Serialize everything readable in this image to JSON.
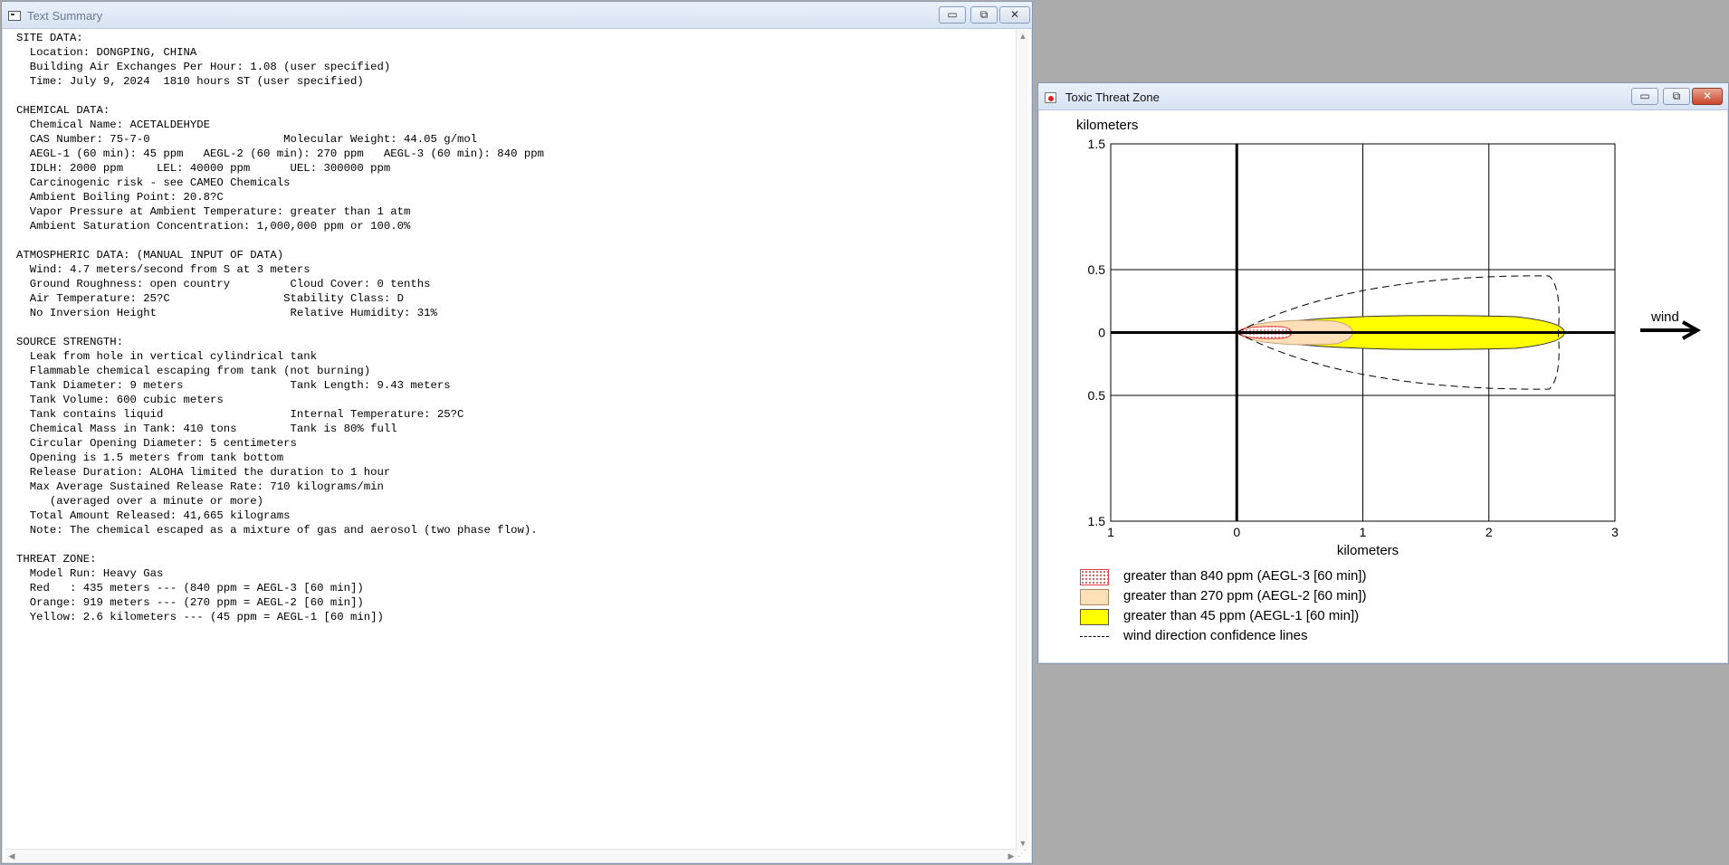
{
  "text_window": {
    "title": "Text Summary",
    "controls": {
      "minimize": "▭",
      "maximize": "⧉",
      "close": "✕"
    },
    "icon": "app-window-icon",
    "lines": [
      "SITE DATA:",
      "  Location: DONGPING, CHINA",
      "  Building Air Exchanges Per Hour: 1.08 (user specified)",
      "  Time: July 9, 2024  1810 hours ST (user specified)",
      "",
      "CHEMICAL DATA:",
      "  Chemical Name: ACETALDEHYDE",
      "  CAS Number: 75-7-0                    Molecular Weight: 44.05 g/mol",
      "  AEGL-1 (60 min): 45 ppm   AEGL-2 (60 min): 270 ppm   AEGL-3 (60 min): 840 ppm",
      "  IDLH: 2000 ppm     LEL: 40000 ppm      UEL: 300000 ppm",
      "  Carcinogenic risk - see CAMEO Chemicals",
      "  Ambient Boiling Point: 20.8?C",
      "  Vapor Pressure at Ambient Temperature: greater than 1 atm",
      "  Ambient Saturation Concentration: 1,000,000 ppm or 100.0%",
      "",
      "ATMOSPHERIC DATA: (MANUAL INPUT OF DATA)",
      "  Wind: 4.7 meters/second from S at 3 meters",
      "  Ground Roughness: open country         Cloud Cover: 0 tenths",
      "  Air Temperature: 25?C                 Stability Class: D",
      "  No Inversion Height                    Relative Humidity: 31%",
      "",
      "SOURCE STRENGTH:",
      "  Leak from hole in vertical cylindrical tank",
      "  Flammable chemical escaping from tank (not burning)",
      "  Tank Diameter: 9 meters                Tank Length: 9.43 meters",
      "  Tank Volume: 600 cubic meters",
      "  Tank contains liquid                   Internal Temperature: 25?C",
      "  Chemical Mass in Tank: 410 tons        Tank is 80% full",
      "  Circular Opening Diameter: 5 centimeters",
      "  Opening is 1.5 meters from tank bottom",
      "  Release Duration: ALOHA limited the duration to 1 hour",
      "  Max Average Sustained Release Rate: 710 kilograms/min",
      "     (averaged over a minute or more)",
      "  Total Amount Released: 41,665 kilograms",
      "  Note: The chemical escaped as a mixture of gas and aerosol (two phase flow).",
      "",
      "THREAT ZONE:",
      "  Model Run: Heavy Gas",
      "  Red   : 435 meters --- (840 ppm = AEGL-3 [60 min])",
      "  Orange: 919 meters --- (270 ppm = AEGL-2 [60 min])",
      "  Yellow: 2.6 kilometers --- (45 ppm = AEGL-1 [60 min])"
    ]
  },
  "threat_window": {
    "title": "Toxic Threat Zone",
    "controls": {
      "minimize": "▭",
      "maximize": "⧉",
      "close": "✕"
    },
    "icon": "threat-zone-icon",
    "wind_label": "wind",
    "legend": [
      {
        "label": "greater than 840 ppm (AEGL-3 [60 min])",
        "color": "#e03a3a",
        "style": "dotted"
      },
      {
        "label": "greater than 270 ppm (AEGL-2 [60 min])",
        "color": "#fde0b8",
        "style": "fill"
      },
      {
        "label": "greater than 45 ppm (AEGL-1 [60 min])",
        "color": "#ffff00",
        "style": "fill"
      },
      {
        "label": "wind direction confidence lines",
        "color": "#000000",
        "style": "dashed"
      }
    ]
  },
  "chart_data": {
    "type": "area",
    "xlabel": "kilometers",
    "ylabel": "kilometers",
    "x_tick_labels": [
      "1",
      "0",
      "1",
      "2",
      "3"
    ],
    "y_tick_labels": [
      "1.5",
      "0.5",
      "0",
      "0.5",
      "1.5"
    ],
    "xlim": [
      -1,
      3
    ],
    "ylim": [
      -1.5,
      1.5
    ],
    "grid": true,
    "zones": [
      {
        "name": "Red",
        "threshold": "840 ppm = AEGL-3 [60 min]",
        "reach_km": 0.435,
        "half_width_km": 0.05,
        "color": "#e03a3a"
      },
      {
        "name": "Orange",
        "threshold": "270 ppm = AEGL-2 [60 min]",
        "reach_km": 0.919,
        "half_width_km": 0.1,
        "color": "#fde0b8"
      },
      {
        "name": "Yellow",
        "threshold": "45 ppm = AEGL-1 [60 min]",
        "reach_km": 2.6,
        "half_width_km": 0.14,
        "color": "#ffff00"
      }
    ],
    "confidence_lines": {
      "reach_km": 2.55,
      "max_half_width_km": 0.45
    },
    "legend_position": "bottom"
  }
}
